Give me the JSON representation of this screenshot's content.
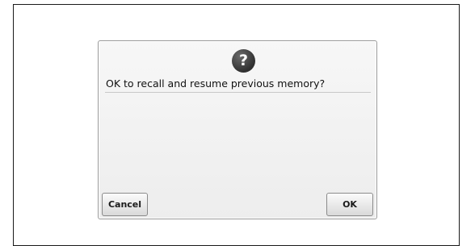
{
  "dialog": {
    "icon": "question-icon",
    "icon_glyph": "?",
    "message": "OK to recall and resume previous memory?",
    "cancel_label": "Cancel",
    "ok_label": "OK"
  },
  "colors": {
    "icon_fill": "#303030",
    "dialog_background": "#f0f0f0",
    "frame_border": "#1a1a1a"
  }
}
